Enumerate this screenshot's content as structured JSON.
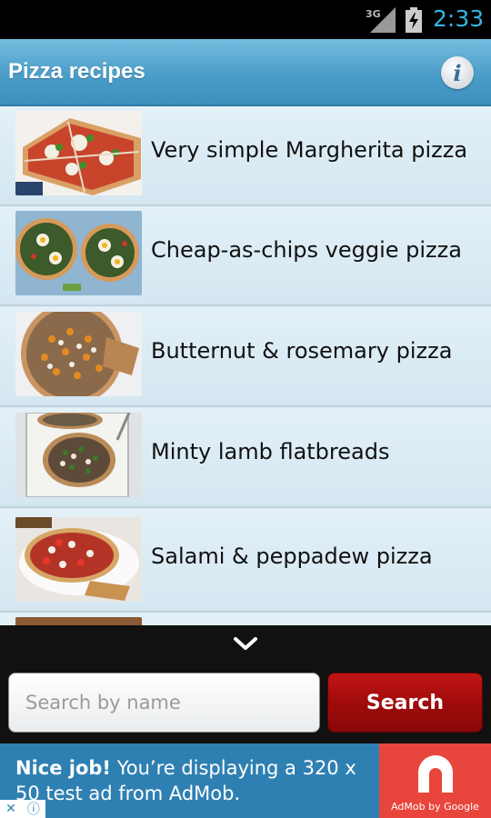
{
  "status_bar": {
    "network": "3G",
    "time": "2:33"
  },
  "app": {
    "title": "Pizza recipes"
  },
  "recipes": [
    {
      "title": "Very simple Margherita pizza"
    },
    {
      "title": "Cheap-as-chips veggie pizza"
    },
    {
      "title": "Butternut & rosemary pizza"
    },
    {
      "title": "Minty lamb flatbreads"
    },
    {
      "title": "Salami & peppadew pizza"
    }
  ],
  "search": {
    "placeholder": "Search by name",
    "button_label": "Search"
  },
  "ad": {
    "lead": "Nice job!",
    "message": " You’re displaying a 320 x 50 test ad from AdMob.",
    "logo_caption": "AdMob by Google"
  },
  "icons": {
    "info": "info-icon",
    "chevron": "chevron-down-icon",
    "signal": "signal-icon",
    "battery": "battery-charging-icon"
  },
  "colors": {
    "status_time": "#33b5e5",
    "action_bar": "#4a9dc8",
    "search_button": "#b01010",
    "ad_background": "#2f80b2"
  }
}
